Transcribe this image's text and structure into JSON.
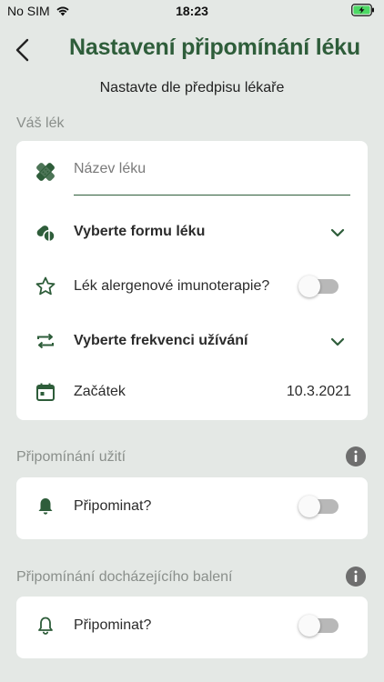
{
  "status_bar": {
    "carrier": "No SIM",
    "time": "18:23",
    "icons": [
      "wifi-icon",
      "battery-charging-icon"
    ]
  },
  "header": {
    "title": "Nastavení připomínání léku",
    "back_icon": "chevron-left-icon"
  },
  "subtitle": "Nastavte dle předpisu lékaře",
  "sections": {
    "medicine": {
      "label": "Váš lék",
      "name_field": {
        "placeholder": "Název léku",
        "value": ""
      },
      "form_select": {
        "label": "Vyberte formu léku"
      },
      "allergen": {
        "label": "Lék alergenové imunoterapie?",
        "enabled": false
      },
      "frequency_select": {
        "label": "Vyberte frekvenci užívání"
      },
      "start": {
        "label": "Začátek",
        "value": "10.3.2021"
      }
    },
    "intake_reminder": {
      "label": "Připomínání užití",
      "toggle_label": "Připominat?",
      "enabled": false
    },
    "package_reminder": {
      "label": "Připomínání docházejícího balení",
      "toggle_label": "Připominat?",
      "enabled": false
    }
  },
  "colors": {
    "accent": "#2e5d3a",
    "background": "#e4e8e5",
    "card": "#ffffff",
    "muted_text": "#8a8f8b",
    "toggle_off": "#b8b8b8",
    "battery_green": "#4cd964"
  }
}
